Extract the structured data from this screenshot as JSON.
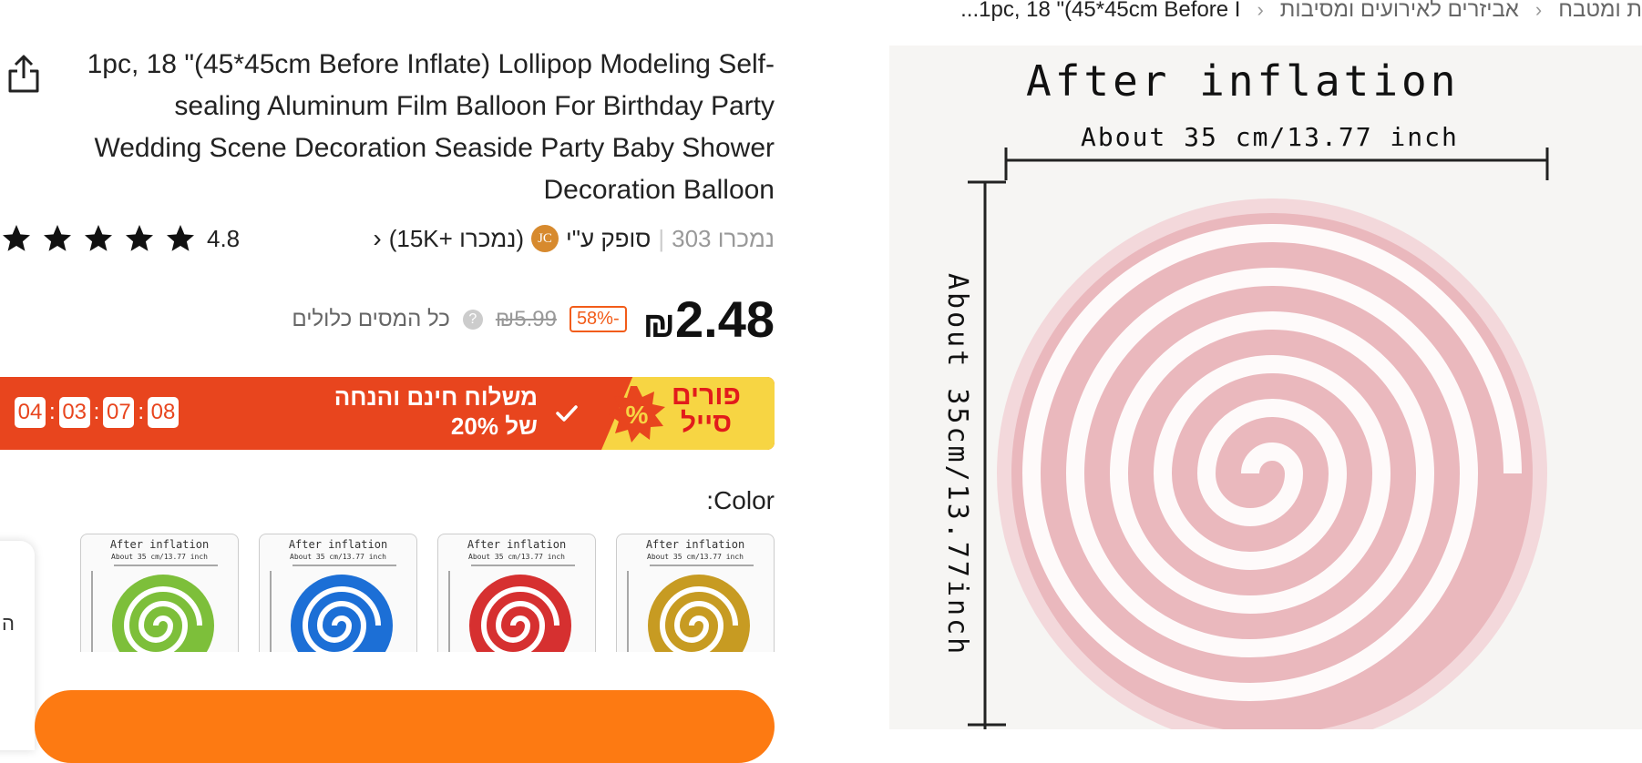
{
  "breadcrumb": {
    "items": [
      "ת ומטבח",
      "אביזרים לאירועים ומסיבות",
      "1pc, 18 \"(45*45cm Before I..."
    ]
  },
  "product": {
    "title": "1pc, 18 \"(45*45cm Before Inflate) Lollipop Modeling Self-sealing Aluminum Film Balloon For Birthday Party Wedding Scene Decoration Seaside Party Baby Shower Decoration Balloon",
    "rating": "4.8",
    "stars": 5,
    "sold": "נמכרו 303",
    "sold_by": "סופק ע\"י",
    "seller_badge": "JC",
    "seller_sold": "(נמכרו +15K)",
    "price": "2.48",
    "currency": "₪",
    "discount": "-58%",
    "old_price": "₪5.99",
    "help": "?",
    "tax_note": "כל המסים כלולים"
  },
  "promo": {
    "sale_title": "פורים סייל",
    "burst_symbol": "%",
    "text_line1": "משלוח חינם והנחה",
    "text_line2": "של 20%",
    "timer": [
      "04",
      "03",
      "07",
      "08"
    ]
  },
  "color": {
    "label": ":Color",
    "options": [
      {
        "name": "green",
        "color": "#7dbf3a"
      },
      {
        "name": "blue",
        "color": "#1c6fd6"
      },
      {
        "name": "red",
        "color": "#d63030"
      },
      {
        "name": "gold",
        "color": "#c79b22"
      }
    ],
    "swatch_title": "After inflation",
    "swatch_sub": "About 35 cm/13.77 inch"
  },
  "image": {
    "title": "After inflation",
    "subtitle": "About 35 cm/13.77 inch",
    "vertical": "About 35cm/13.77inch",
    "balloon_color": "#eab8bd",
    "stripe_color": "#ffffff"
  },
  "side": {
    "char": "ה"
  },
  "buy": {
    "label": ""
  },
  "colors": {
    "accent": "#fd7a12",
    "promo": "#e8451e",
    "promo_yellow": "#f7d543"
  }
}
